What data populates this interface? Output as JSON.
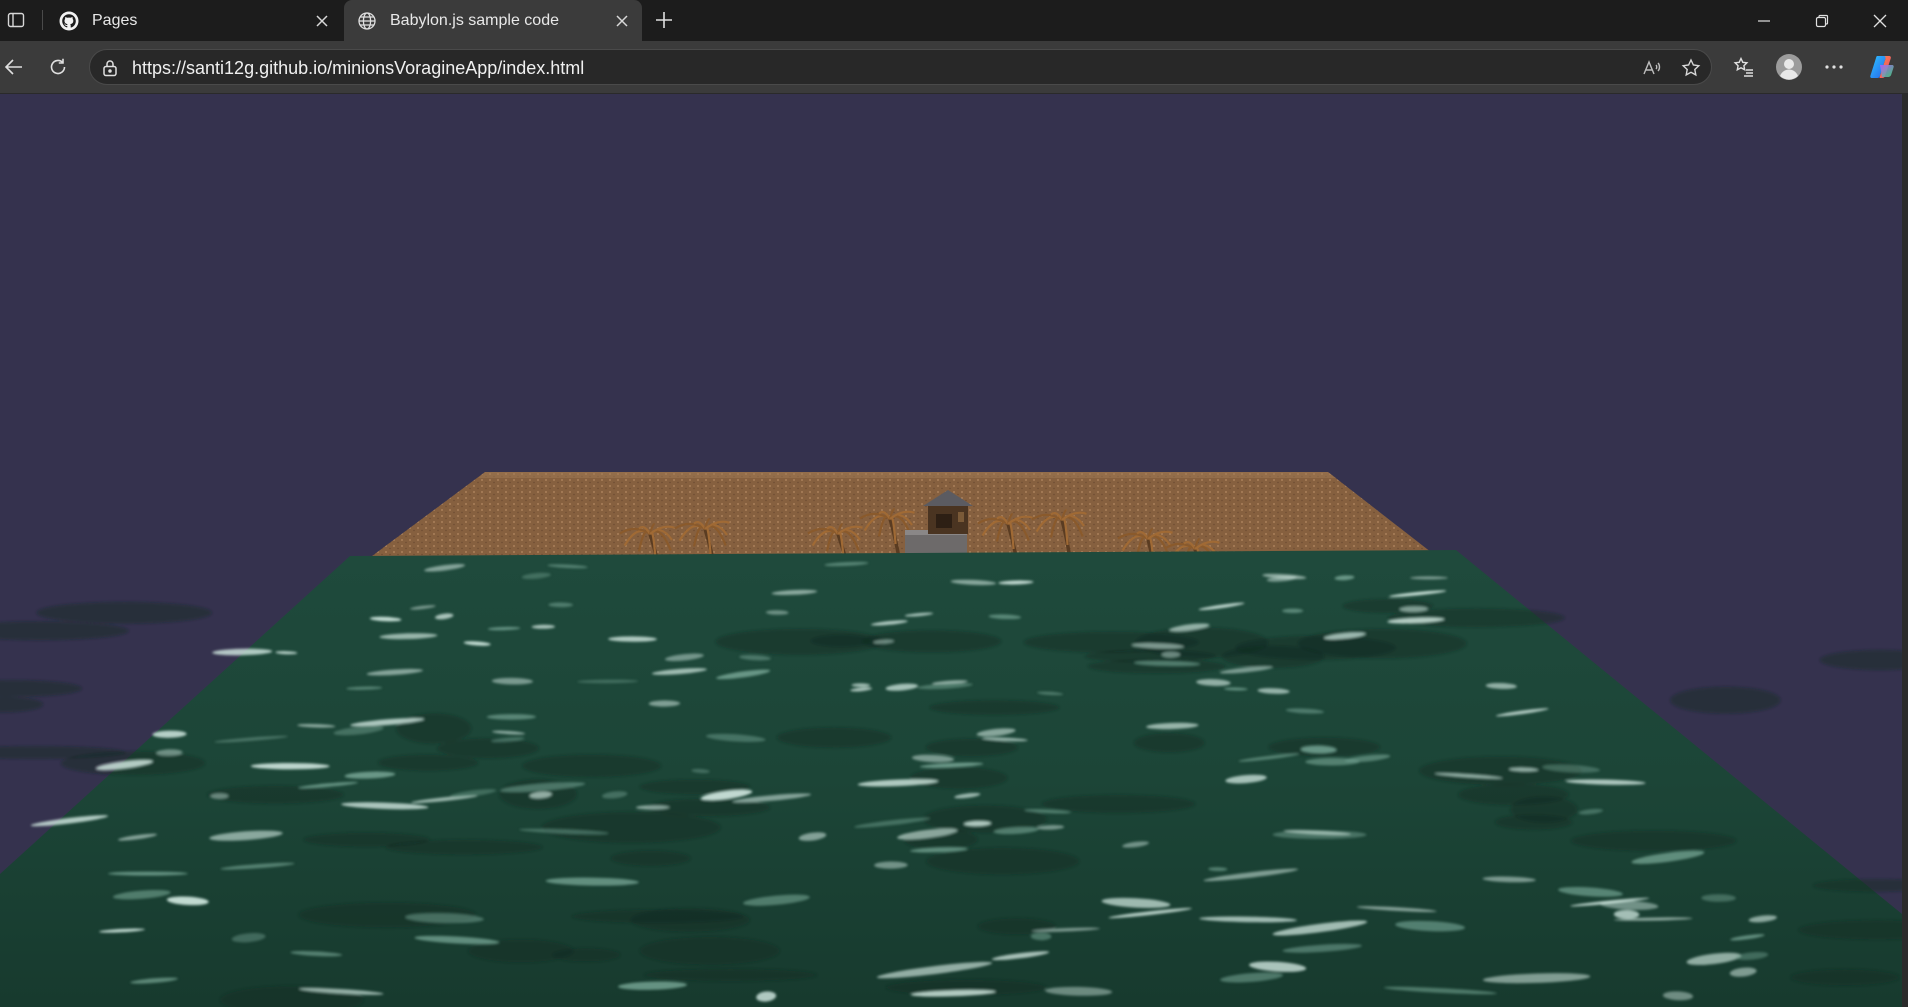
{
  "tabs": [
    {
      "title": "Pages",
      "favicon": "github-icon",
      "active": false
    },
    {
      "title": "Babylon.js sample code",
      "favicon": "globe-icon",
      "active": true
    }
  ],
  "address_bar": {
    "url": "https://santi12g.github.io/minionsVoragineApp/index.html"
  },
  "scene": {
    "sky_color": "#35324e",
    "water_color": "#1d4a3a",
    "sand_color": "#8b6444",
    "palm_trees": 10
  }
}
